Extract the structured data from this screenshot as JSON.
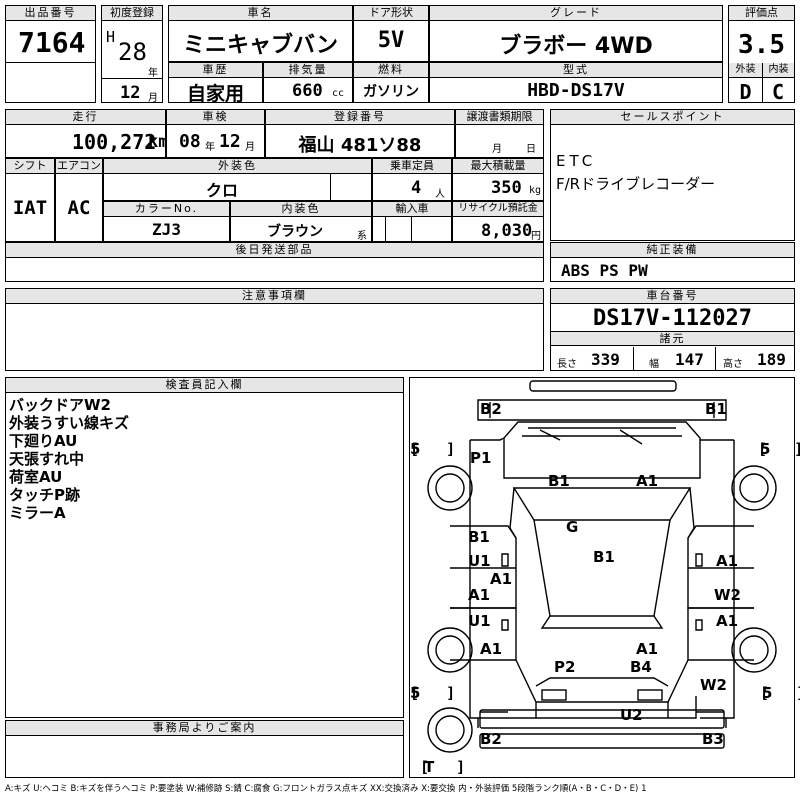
{
  "lot": {
    "label": "出品番号",
    "value": "7164"
  },
  "first_reg": {
    "label": "初度登録",
    "era": "H",
    "year": "28",
    "year_unit": "年",
    "month": "12",
    "month_unit": "月"
  },
  "car_name": {
    "label": "車名",
    "value": "ミニキャブバン"
  },
  "door": {
    "label": "ドア形状",
    "value": "5V"
  },
  "grade": {
    "label": "グレード",
    "value": "ブラボー 4WD"
  },
  "score": {
    "label": "評価点",
    "value": "3.5",
    "ext_label": "外装",
    "int_label": "内装",
    "ext": "D",
    "int": "C"
  },
  "history": {
    "label": "車歴",
    "value": "自家用"
  },
  "displacement": {
    "label": "排気量",
    "value": "660",
    "unit": "cc"
  },
  "fuel": {
    "label": "燃料",
    "value": "ガソリン"
  },
  "model": {
    "label": "型式",
    "value": "HBD-DS17V"
  },
  "mileage": {
    "label": "走行",
    "value": "100,272",
    "unit": "km"
  },
  "inspection": {
    "label": "車検",
    "year": "08",
    "year_unit": "年",
    "month": "12",
    "month_unit": "月"
  },
  "registration": {
    "label": "登録番号",
    "value": "福山 481ソ88"
  },
  "transfer": {
    "label": "譲渡書類期限",
    "month_unit": "月",
    "day_unit": "日"
  },
  "shift": {
    "label": "シフト",
    "value": "IAT"
  },
  "aircon": {
    "label": "エアコン",
    "value": "AC"
  },
  "exterior_color": {
    "label": "外装色",
    "value": "クロ"
  },
  "capacity": {
    "label": "乗車定員",
    "value": "4",
    "unit": "人"
  },
  "max_load": {
    "label": "最大積載量",
    "value": "350",
    "unit": "kg"
  },
  "color_no": {
    "label": "カラーNo.",
    "value": "ZJ3"
  },
  "interior_color": {
    "label": "内装色",
    "value": "ブラウン",
    "suffix": "系"
  },
  "import": {
    "label": "輸入車",
    "value": ""
  },
  "recycle": {
    "label": "リサイクル預託金",
    "value": "8,030",
    "unit": "円"
  },
  "sales_points": {
    "label": "セールスポイント",
    "lines": [
      "ETC",
      "F/Rドライブレコーダー"
    ]
  },
  "later_parts": {
    "label": "後日発送部品",
    "value": ""
  },
  "genuine": {
    "label": "純正装備",
    "value": "ABS PS PW"
  },
  "caution": {
    "label": "注意事項欄",
    "value": ""
  },
  "chassis": {
    "label": "車台番号",
    "value": "DS17V-112027"
  },
  "dimensions": {
    "label": "諸元",
    "length_label": "長さ",
    "length": "339",
    "width_label": "幅",
    "width": "147",
    "height_label": "高さ",
    "height": "189"
  },
  "inspector": {
    "label": "検査員記入欄",
    "lines": [
      "バックドアW2",
      "外装うすい線キズ",
      "下廻りAU",
      "天張すれ中",
      "荷室AU",
      "タッチP跡",
      "ミラーA"
    ]
  },
  "office": {
    "label": "事務局よりご案内",
    "value": ""
  },
  "legend": "A:キズ U:ヘコミ B:キズを伴うヘコミ P:要塗装 W:補修跡 S:錆 C:腐食 G:フロントガラス点キズ XX:交換済み X:要交換 内・外装評価 5段階ランク順(A・B・C・D・E) 1",
  "diagram": {
    "tires": [
      "5",
      "5",
      "5",
      "5",
      "T"
    ],
    "marks": [
      "B2",
      "B1",
      "P1",
      "B1",
      "A1",
      "G",
      "B1",
      "U1",
      "A1",
      "B1",
      "A1",
      "A1",
      "U1",
      "W2",
      "A1",
      "A1",
      "A1",
      "P2",
      "B4",
      "W2",
      "U2",
      "B2",
      "B3"
    ]
  }
}
